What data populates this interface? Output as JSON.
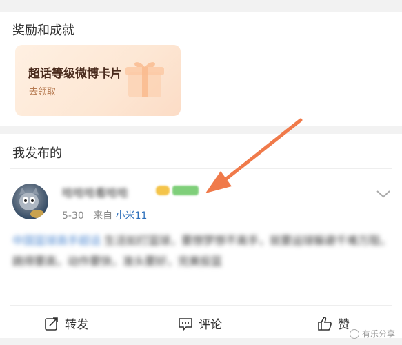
{
  "rewards": {
    "title": "奖励和成就",
    "card": {
      "title": "超话等级微博卡片",
      "action": "去领取"
    }
  },
  "posts": {
    "title": "我发布的",
    "item": {
      "username": "哈哈哈看哈哈",
      "date": "5-30",
      "source_prefix": "来自",
      "source": "小米11",
      "body_topic": "中国篮球高手超话",
      "body_text": " 生活如打篮球，要想梦想不离手，就要运球躲避千难万阻，跳得要高，动作要快，准头要好，完美投篮"
    },
    "actions": {
      "repost": "转发",
      "comment": "评论",
      "like": "赞"
    }
  },
  "watermark": "有乐分享",
  "colors": {
    "arrow": "#f07a4a",
    "link": "#2c6fbb",
    "topic": "#4c87d0"
  }
}
